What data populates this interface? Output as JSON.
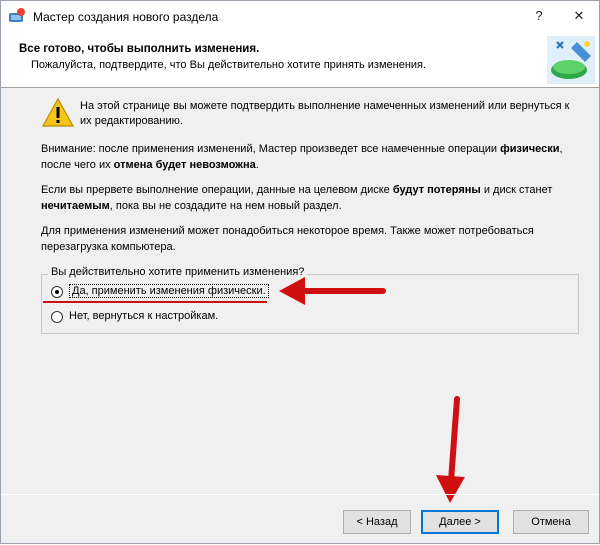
{
  "window": {
    "title": "Мастер создания нового раздела",
    "help_button": "?",
    "close_button": "✕"
  },
  "header": {
    "title": "Все готово, чтобы выполнить изменения.",
    "subtitle": "Пожалуйста, подтвердите, что Вы действительно хотите принять изменения."
  },
  "content": {
    "warning": "На этой странице вы можете подтвердить выполнение намеченных изменений или вернуться к их редактированию.",
    "para1_a": "Внимание: после применения изменений, Мастер произведет все намеченные операции ",
    "para1_b": "физически",
    "para1_c": ", после чего их ",
    "para1_d": "отмена будет невозможна",
    "para1_e": ".",
    "para2_a": "Если вы прервете выполнение операции, данные на целевом диске ",
    "para2_b": "будут потеряны",
    "para2_c": " и диск станет ",
    "para2_d": "нечитаемым",
    "para2_e": ", пока вы не создадите на нем новый раздел.",
    "para3": "Для применения изменений может понадобиться некоторое время. Также может потребоваться перезагрузка компьютера."
  },
  "confirm_group": {
    "legend": "Вы действительно хотите применить изменения?",
    "options": [
      {
        "label": "Да, применить изменения физически.",
        "checked": true
      },
      {
        "label": "Нет, вернуться к настройкам.",
        "checked": false
      }
    ]
  },
  "buttons": {
    "back": "< Назад",
    "next": "Далее >",
    "cancel": "Отмена"
  },
  "colors": {
    "annotation": "#d01010",
    "default_button_border": "#0078d7"
  }
}
